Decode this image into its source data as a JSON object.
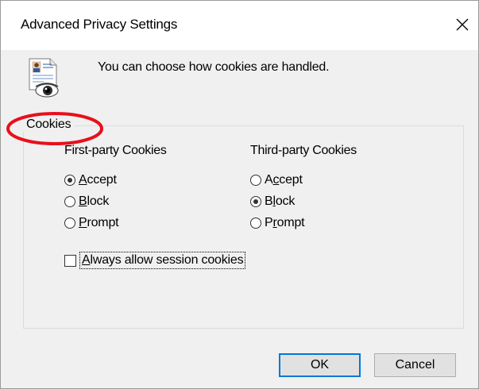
{
  "window": {
    "title": "Advanced Privacy Settings",
    "close_icon": "close-icon"
  },
  "intro": {
    "icon": "privacy-document-eye-icon",
    "text": "You can choose how cookies are handled."
  },
  "cookies_group": {
    "label": "Cookies",
    "first_party": {
      "header": "First-party Cookies",
      "options": [
        {
          "label_ul": "A",
          "label_rest": "ccept",
          "label": "Accept",
          "checked": true
        },
        {
          "label_ul": "B",
          "label_rest": "lock",
          "label": "Block",
          "checked": false
        },
        {
          "label_ul": "P",
          "label_rest": "rompt",
          "label": "Prompt",
          "checked": false
        }
      ]
    },
    "third_party": {
      "header": "Third-party Cookies",
      "options": [
        {
          "label_pre": "A",
          "label_ul": "c",
          "label_rest": "cept",
          "label": "Accept",
          "checked": false
        },
        {
          "label_pre": "B",
          "label_ul": "l",
          "label_rest": "ock",
          "label": "Block",
          "checked": true
        },
        {
          "label_pre": "P",
          "label_ul": "r",
          "label_rest": "ompt",
          "label": "Prompt",
          "checked": false
        }
      ]
    },
    "session_cookies": {
      "label_pre": "",
      "label_ul": "A",
      "label_rest": "lways allow session cookies",
      "label": "Always allow session cookies",
      "checked": false
    }
  },
  "buttons": {
    "ok": "OK",
    "cancel": "Cancel"
  },
  "colors": {
    "highlight_ring": "#e8101b",
    "default_button_border": "#0078d7",
    "dialog_background": "#f0f0f0"
  }
}
